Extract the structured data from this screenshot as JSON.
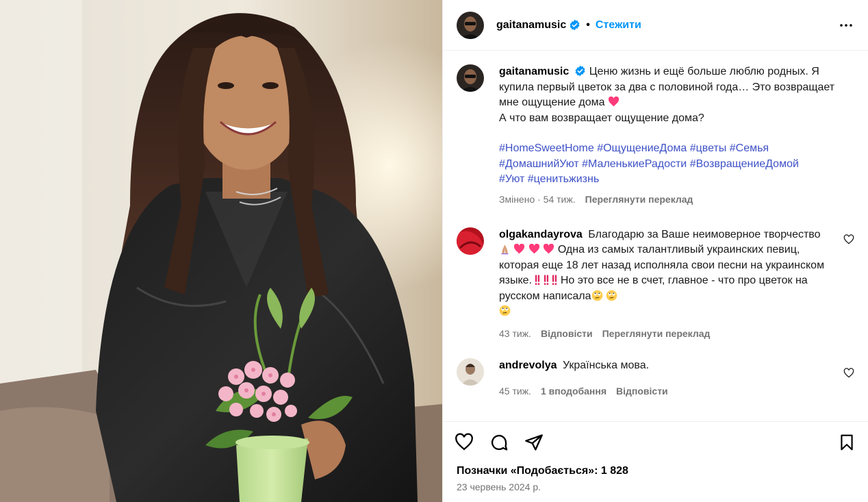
{
  "post": {
    "username": "gaitanamusic",
    "follow_label": "Стежити",
    "dot": "•"
  },
  "caption": {
    "username": "gaitanamusic",
    "text_line1": "Ценю жизнь и ещё больше люблю родных. Я купила первый цветок за два с половиной года… Это возвращает мне ощущение дома",
    "text_line2": "А что вам возвращает ощущение дома?",
    "hashtags": [
      "#HomeSweetHome",
      "#ОщущениеДома",
      "#цветы",
      "#Семья",
      "#ДомашнийУют",
      "#МаленькиеРадости",
      "#ВозвращениеДомой",
      "#Уют",
      "#ценитьжизнь"
    ],
    "meta_time": "Змінено · 54 тиж.",
    "translate_label": "Переглянути переклад"
  },
  "comments": [
    {
      "username": "olgakandayrova",
      "text_a": "Благодарю за Ваше неимоверное творчество",
      "text_b": "Одна из самых талантливый украинских певиц, которая еще 18 лет назад исполняла свои песни на украинском языке.",
      "text_c": "Но это все не в счет, главное - что про цветок на русском написала",
      "time": "43 тиж.",
      "reply_label": "Відповісти",
      "translate_label": "Переглянути переклад"
    },
    {
      "username": "andrevolya",
      "text": "Українська мова.",
      "time": "45 тиж.",
      "likes_label": "1 вподобання",
      "reply_label": "Відповісти"
    }
  ],
  "footer": {
    "likes_text": "Позначки «Подобається»: 1 828",
    "date": "23 червень 2024 р."
  },
  "colors": {
    "link_blue": "#0095f6",
    "hashtag": "#3e51c6",
    "muted": "#737373",
    "heart": "#ff3b7a"
  }
}
